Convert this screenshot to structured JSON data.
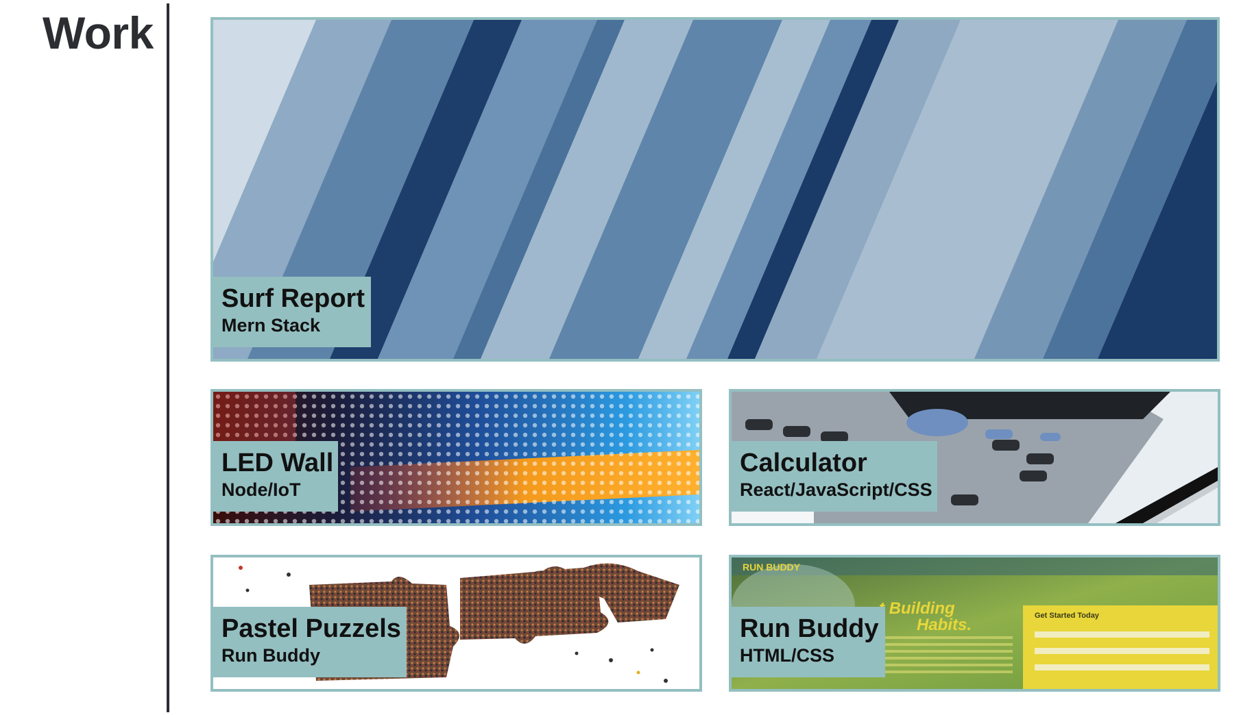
{
  "section": {
    "title": "Work"
  },
  "projects": [
    {
      "title": "Surf Report",
      "subtitle": "Mern Stack",
      "image": "blue-diagonal-stripes"
    },
    {
      "title": "LED Wall",
      "subtitle": "Node/IoT",
      "image": "led-matrix"
    },
    {
      "title": "Calculator",
      "subtitle": "React/JavaScript/CSS",
      "image": "calculator-and-pen"
    },
    {
      "title": "Pastel Puzzels",
      "subtitle": "Run Buddy",
      "image": "crowd-puzzle-pieces"
    },
    {
      "title": "Run Buddy",
      "subtitle": "HTML/CSS",
      "image": "run-buddy-site"
    }
  ],
  "run_buddy_art": {
    "brand": "RUN BUDDY",
    "headline_1": "t Building",
    "headline_2": "Habits.",
    "form_title": "Get Started Today"
  },
  "colors": {
    "accent": "#94bfc1",
    "text": "#2b2d31"
  }
}
